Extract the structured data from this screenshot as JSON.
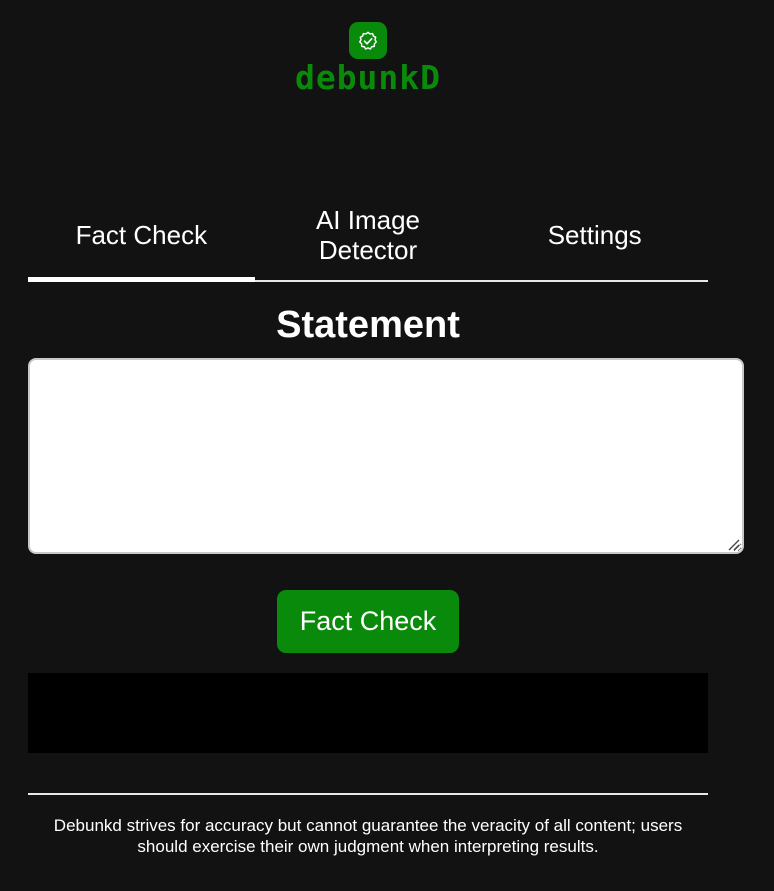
{
  "brand": {
    "name": "debunkD",
    "logo_icon": "verified-badge-check-icon",
    "accent_color": "#0a8a0a"
  },
  "tabs": [
    {
      "label": "Fact Check",
      "active": true
    },
    {
      "label": "AI Image\nDetector",
      "active": false
    },
    {
      "label": "Settings",
      "active": false
    }
  ],
  "main": {
    "section_title": "Statement",
    "statement_value": "",
    "submit_label": "Fact Check"
  },
  "footer": {
    "disclaimer": "Debunkd strives for accuracy but cannot guarantee the veracity of all content; users should exercise their own judgment when interpreting results."
  }
}
